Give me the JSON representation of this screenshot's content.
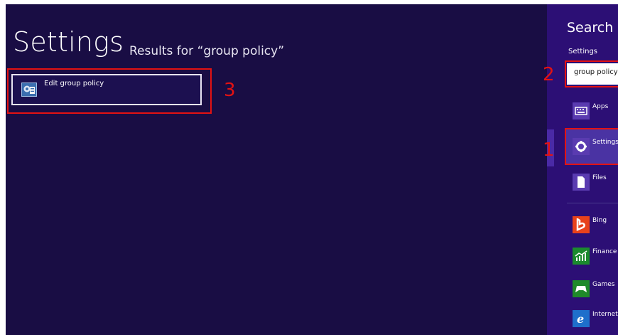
{
  "main": {
    "title": "Settings",
    "subtitle": "Results for “group policy”",
    "results": [
      {
        "label": "Edit group policy",
        "icon": "group-policy-icon"
      }
    ]
  },
  "search_panel": {
    "title": "Search",
    "scope": "Settings",
    "query": "group policy",
    "categories": [
      {
        "label": "Apps",
        "icon": "keyboard-icon",
        "color": "#5a3bb0"
      },
      {
        "label": "Settings",
        "icon": "gear-icon",
        "color": "#5a3bb0"
      },
      {
        "label": "Files",
        "icon": "document-icon",
        "color": "#5a3bb0"
      },
      {
        "label": "Bing",
        "icon": "bing-icon",
        "color": "#e8421b"
      },
      {
        "label": "Finance",
        "icon": "finance-chart-icon",
        "color": "#1b8a2e"
      },
      {
        "label": "Games",
        "icon": "game-controller-icon",
        "color": "#1f8a2a"
      },
      {
        "label": "Internet Explorer",
        "icon": "internet-explorer-icon",
        "color": "#1e6fcb"
      }
    ]
  },
  "annotations": [
    "1",
    "2",
    "3"
  ],
  "colors": {
    "background": "#190d44",
    "panel": "#2c0f75",
    "annotation": "#e41212"
  }
}
